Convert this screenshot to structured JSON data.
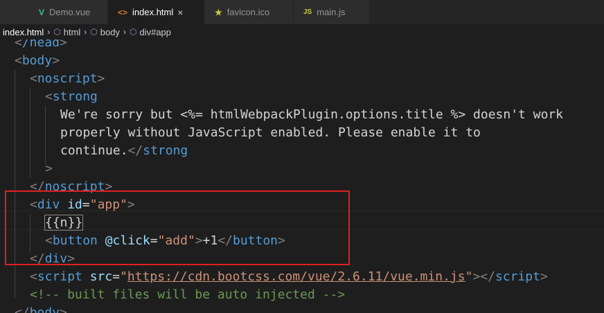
{
  "tabs": [
    {
      "label": "Demo.vue",
      "icon": "vue-icon",
      "icon_glyph": "V",
      "icon_color": "#41b883",
      "active": false
    },
    {
      "label": "index.html",
      "icon": "html-icon",
      "icon_glyph": "<>",
      "icon_color": "#e37933",
      "active": true
    },
    {
      "label": "favicon.ico",
      "icon": "star-icon",
      "icon_glyph": "★",
      "icon_color": "#cbcb41",
      "active": false
    },
    {
      "label": "main.js",
      "icon": "js-icon",
      "icon_glyph": "JS",
      "icon_color": "#cbcb41",
      "active": false
    }
  ],
  "tab_close_glyph": "×",
  "breadcrumb": {
    "file": "index.html",
    "items": [
      "html",
      "body",
      "div#app"
    ],
    "separator": "›"
  },
  "code": {
    "l0_tag": "/head",
    "l1_tag": "body",
    "l2_tag": "noscript",
    "l3_tag": "strong",
    "l4_text": "We're sorry but <%= htmlWebpackPlugin.options.title %> doesn't work",
    "l5_text": "properly without JavaScript enabled. Please enable it to",
    "l6_text": "continue.",
    "l6_tag": "strong",
    "l7_text": ">",
    "l8_tag": "noscript",
    "l9_tag": "div",
    "l9_attr": "id",
    "l9_val": "\"app\"",
    "l10_text": "{{n}}",
    "l11_tag": "button",
    "l11_attr": "@click",
    "l11_val": "\"add\"",
    "l11_text": "+1",
    "l12_tag": "div",
    "l13_tag": "script",
    "l13_attr": "src",
    "l13_val": "https://cdn.bootcss.com/vue/2.6.11/vue.min.js",
    "l14_comment": "<!-- built files will be auto injected -->",
    "l15_tag": "body"
  },
  "colors": {
    "tag": "#569cd6",
    "attribute": "#9cdcfe",
    "string": "#ce9178",
    "comment": "#6a9955",
    "highlight_box": "#e02020"
  }
}
